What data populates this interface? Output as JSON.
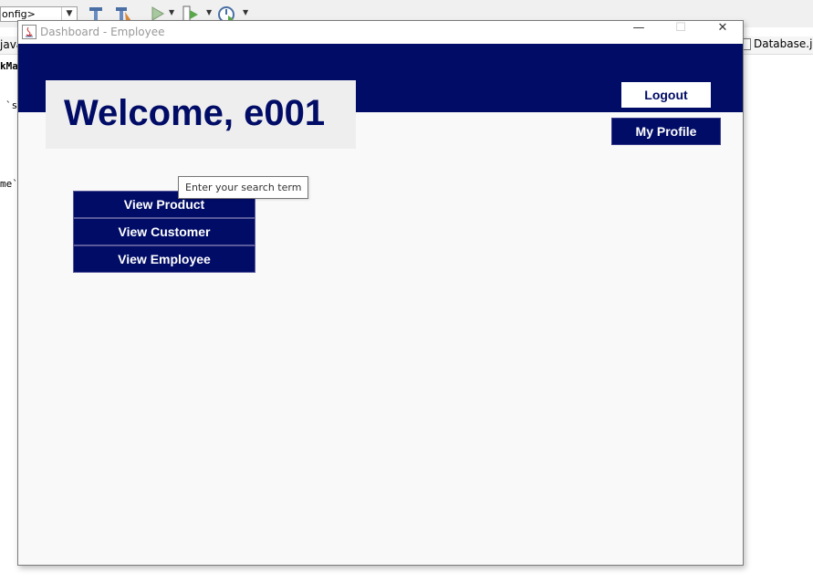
{
  "ide": {
    "config_value": "onfig>",
    "left_tab_fragment": "java",
    "right_tab_label": "Database.java",
    "code_fragments": [
      "kMa",
      "`s",
      "me`"
    ]
  },
  "window": {
    "title": "Dashboard - Employee",
    "minimize": "—",
    "maximize": "☐",
    "close": "✕"
  },
  "header": {
    "welcome": "Welcome, e001",
    "logout_label": "Logout",
    "profile_label": "My Profile",
    "brand_color": "#000c66"
  },
  "menu": {
    "items": [
      {
        "label": "View Product"
      },
      {
        "label": "View Customer"
      },
      {
        "label": "View Employee"
      }
    ]
  },
  "tooltip": {
    "text": "Enter your search term"
  }
}
